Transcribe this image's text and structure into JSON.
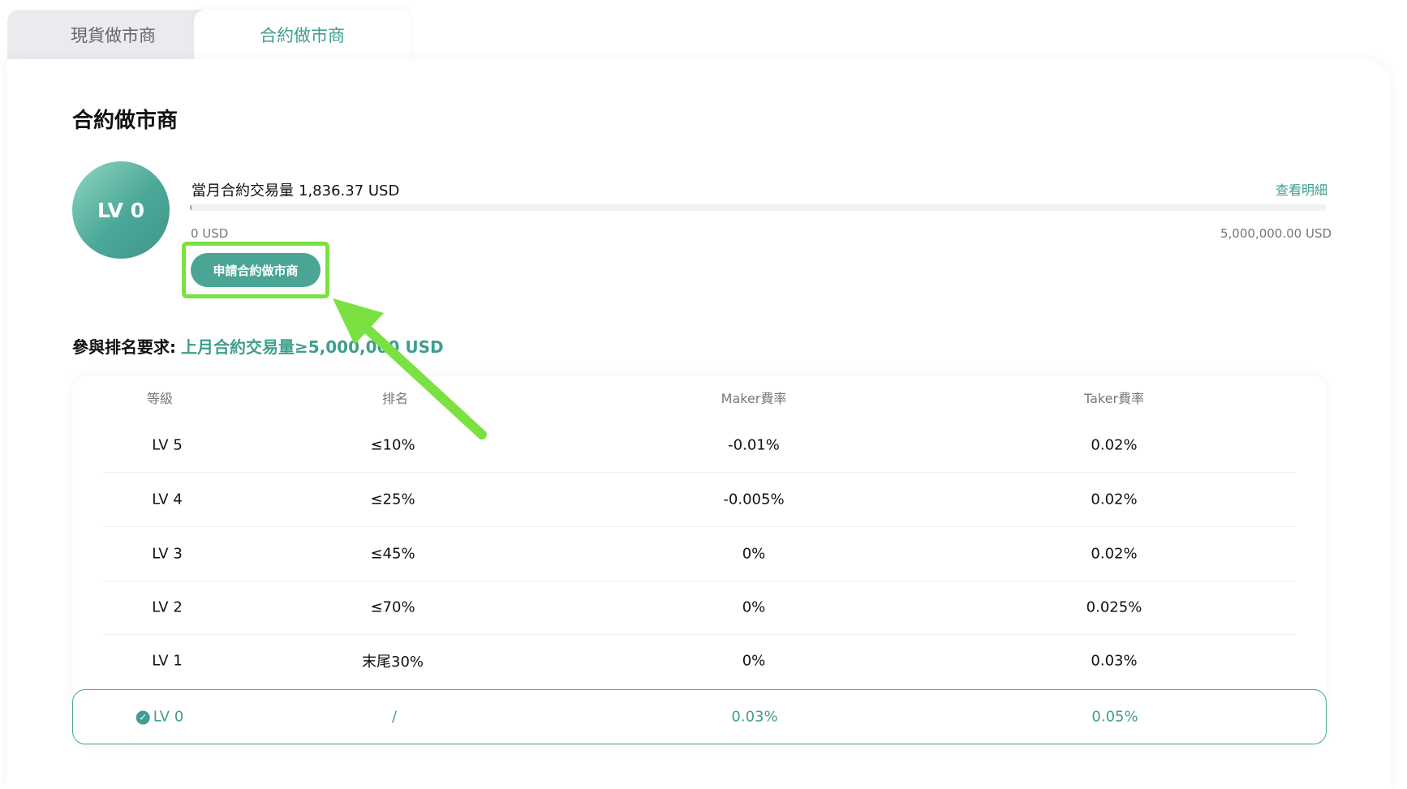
{
  "tabs": [
    {
      "label": "現貨做市商",
      "active": false
    },
    {
      "label": "合約做市商",
      "active": true
    }
  ],
  "page_title": "合約做市商",
  "level_badge": "LV 0",
  "volume": {
    "label": "當月合約交易量",
    "value": "1,836.37 USD",
    "detail_link": "查看明細",
    "min_label": "0 USD",
    "max_label": "5,000,000.00 USD",
    "progress_fraction": 0.0004
  },
  "apply_button": "申請合約做市商",
  "requirement": {
    "label": "參與排名要求:",
    "value": "上月合約交易量≥5,000,000 USD"
  },
  "table": {
    "headers": [
      "等級",
      "排名",
      "Maker費率",
      "Taker費率"
    ],
    "rows": [
      {
        "level": "LV 5",
        "rank": "≤10%",
        "maker": "-0.01%",
        "taker": "0.02%"
      },
      {
        "level": "LV 4",
        "rank": "≤25%",
        "maker": "-0.005%",
        "taker": "0.02%"
      },
      {
        "level": "LV 3",
        "rank": "≤45%",
        "maker": "0%",
        "taker": "0.02%"
      },
      {
        "level": "LV 2",
        "rank": "≤70%",
        "maker": "0%",
        "taker": "0.025%"
      },
      {
        "level": "LV 1",
        "rank": "末尾30%",
        "maker": "0%",
        "taker": "0.03%"
      }
    ],
    "current": {
      "level": "LV 0",
      "rank": "/",
      "maker": "0.03%",
      "taker": "0.05%"
    }
  },
  "colors": {
    "accent": "#3f9e8f",
    "button": "#4aa595",
    "highlight": "#7be041"
  }
}
